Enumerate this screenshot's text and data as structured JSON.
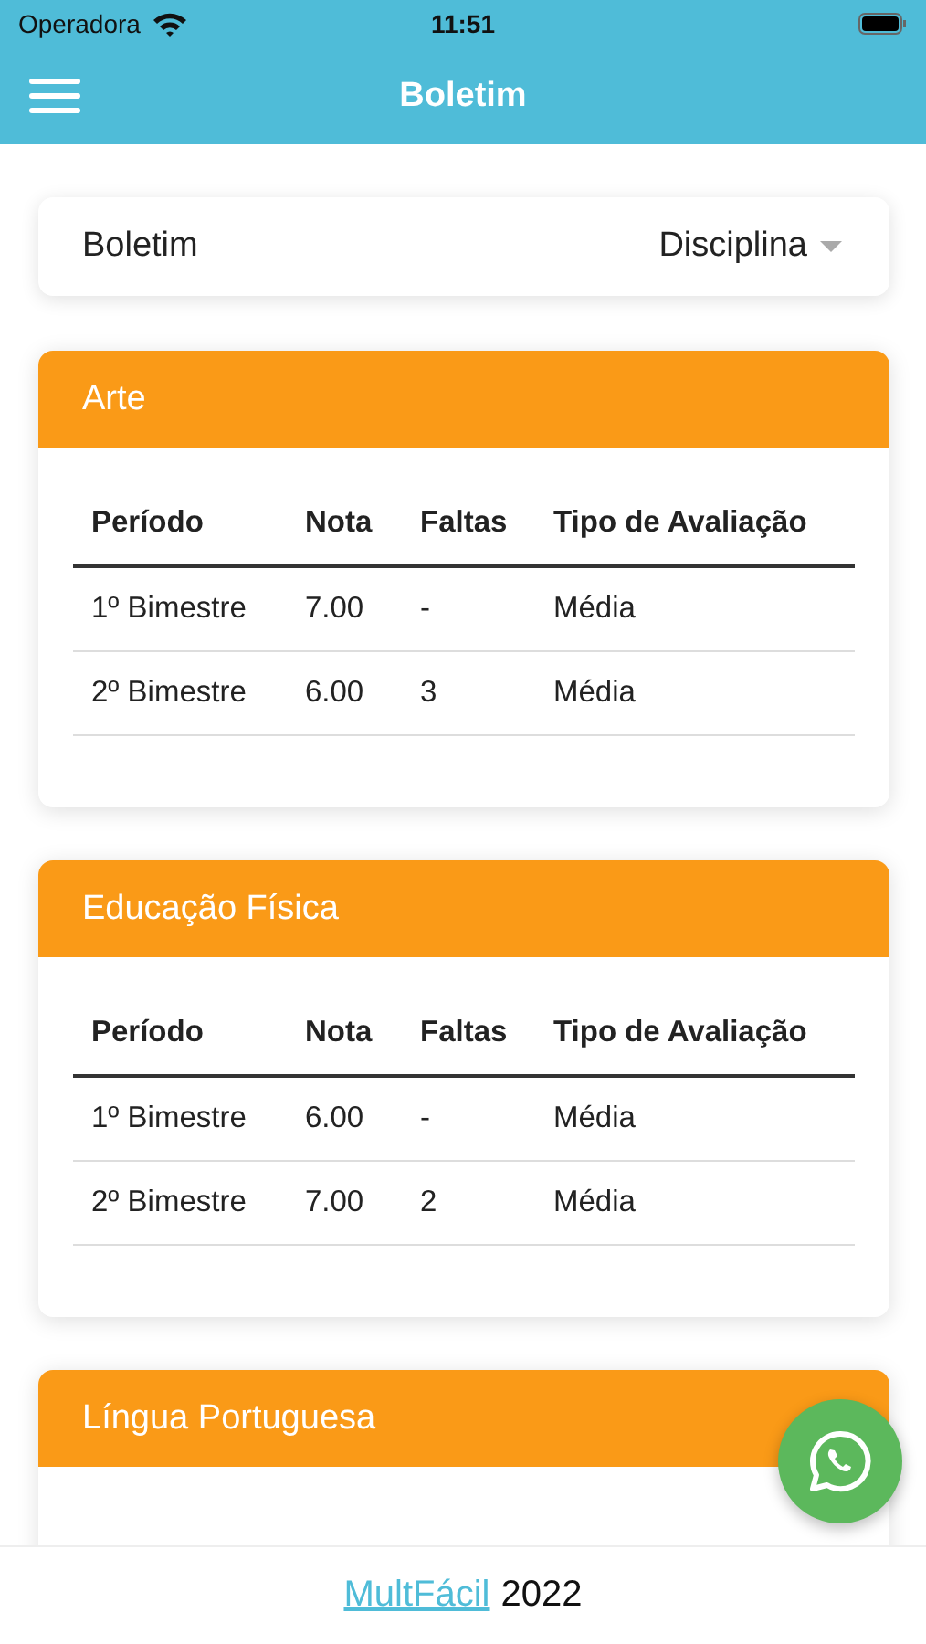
{
  "status_bar": {
    "carrier": "Operadora",
    "time": "11:51"
  },
  "header": {
    "title": "Boletim"
  },
  "selector": {
    "label": "Boletim",
    "value": "Disciplina"
  },
  "cards": [
    {
      "title": "Arte",
      "columns": [
        "Período",
        "Nota",
        "Faltas",
        "Tipo de Avaliação"
      ],
      "rows": [
        [
          "1º Bimestre",
          "7.00",
          "-",
          "Média"
        ],
        [
          "2º Bimestre",
          "6.00",
          "3",
          "Média"
        ]
      ]
    },
    {
      "title": "Educação Física",
      "columns": [
        "Período",
        "Nota",
        "Faltas",
        "Tipo de Avaliação"
      ],
      "rows": [
        [
          "1º Bimestre",
          "6.00",
          "-",
          "Média"
        ],
        [
          "2º Bimestre",
          "7.00",
          "2",
          "Média"
        ]
      ]
    },
    {
      "title": "Língua Portuguesa"
    }
  ],
  "footer": {
    "link": "MultFácil",
    "text": "2022"
  }
}
